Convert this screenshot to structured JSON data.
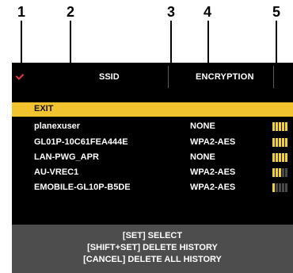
{
  "callouts": [
    "1",
    "2",
    "3",
    "4",
    "5"
  ],
  "header": {
    "ssid_label": "SSID",
    "encryption_label": "ENCRYPTION"
  },
  "exit_label": "EXIT",
  "networks": [
    {
      "ssid": "planexuser",
      "encryption": "NONE",
      "signal_bars": 5
    },
    {
      "ssid": "GL01P-10C61FEA444E",
      "encryption": "WPA2-AES",
      "signal_bars": 5
    },
    {
      "ssid": "LAN-PWG_APR",
      "encryption": "NONE",
      "signal_bars": 5
    },
    {
      "ssid": "AU-VREC1",
      "encryption": "WPA2-AES",
      "signal_bars": 3
    },
    {
      "ssid": "EMOBILE-GL10P-B5DE",
      "encryption": "WPA2-AES",
      "signal_bars": 1
    }
  ],
  "signal_max_bars": 5,
  "footer": {
    "line1": "[SET] SELECT",
    "line2": "[SHIFT+SET] DELETE HISTORY",
    "line3": "[CANCEL] DELETE ALL HISTORY"
  },
  "colors": {
    "highlight": "#f2c32e",
    "signal_on": "#f5d51c",
    "signal_off": "#4a4a4a",
    "check": "#e8384b"
  }
}
